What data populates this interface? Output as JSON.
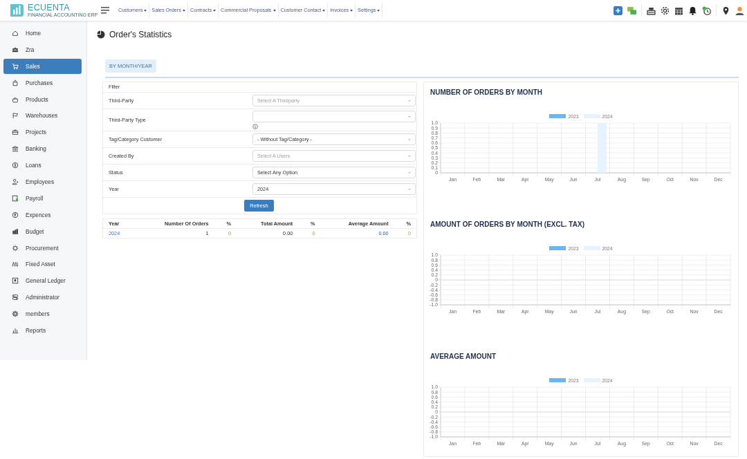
{
  "logo": {
    "name": "ECUENTA",
    "tagline": "FINANCIAL ACCOUNTING ERP"
  },
  "menu": [
    {
      "label": "Customers"
    },
    {
      "label": "Sales Orders"
    },
    {
      "label": "Contracts"
    },
    {
      "label": "Commercial Proposals"
    },
    {
      "label": "Customer Contact"
    },
    {
      "label": "Invoices"
    },
    {
      "label": "Settings"
    }
  ],
  "sidebar": {
    "items": [
      {
        "label": "Home",
        "selected": false
      },
      {
        "label": "Zra",
        "selected": false
      },
      {
        "label": "Sales",
        "selected": true
      },
      {
        "label": "Purchases",
        "selected": false
      },
      {
        "label": "Products",
        "selected": false
      },
      {
        "label": "Warehouses",
        "selected": false
      },
      {
        "label": "Projects",
        "selected": false
      },
      {
        "label": "Banking",
        "selected": false
      },
      {
        "label": "Loans",
        "selected": false
      },
      {
        "label": "Employees",
        "selected": false
      },
      {
        "label": "Payroll",
        "selected": false
      },
      {
        "label": "Expences",
        "selected": false
      },
      {
        "label": "Budget",
        "selected": false
      },
      {
        "label": "Procurement",
        "selected": false
      },
      {
        "label": "Fixed Asset",
        "selected": false
      },
      {
        "label": "General Ledger",
        "selected": false
      },
      {
        "label": "Administrator",
        "selected": false
      },
      {
        "label": "members",
        "selected": false
      },
      {
        "label": "Reports",
        "selected": false
      }
    ]
  },
  "page": {
    "title": "Order's Statistics"
  },
  "tabs": [
    {
      "label": "BY MONTH/YEAR",
      "selected": true
    }
  ],
  "filter": {
    "title": "Filter",
    "fields": [
      {
        "label": "Third-Party",
        "placeholder": "Select A Thirdparty",
        "info": false
      },
      {
        "label": "Third-Party Type",
        "info": true
      },
      {
        "label": "Tag/Category Customer",
        "value": "- Without Tag/Category -",
        "info": false
      },
      {
        "label": "Created By",
        "placeholder": "Select A Users",
        "info": false
      },
      {
        "label": "Status",
        "value": "Select Any Option",
        "info": false
      },
      {
        "label": "Year",
        "value": "2024",
        "info": false
      }
    ],
    "button": "Refresh"
  },
  "table": {
    "columns": [
      "Year",
      "Number Of Orders",
      "%",
      "Total Amount",
      "%",
      "Average Amount",
      "%"
    ],
    "rows": [
      [
        {
          "text": "2024",
          "kind": "link"
        },
        {
          "text": "1",
          "kind": "number"
        },
        {
          "text": "0",
          "kind": "percent"
        },
        {
          "text": "0.00",
          "kind": "number"
        },
        {
          "text": "0",
          "kind": "percent"
        },
        {
          "text": "0.00",
          "kind": "amount"
        },
        {
          "text": "0",
          "kind": "percent"
        }
      ]
    ]
  },
  "charts": [
    {
      "title": "NUMBER OF ORDERS BY MONTH",
      "chart_data": {
        "type": "bar",
        "grid": true,
        "categories": [
          "Jan",
          "Feb",
          "Mar",
          "Apr",
          "May",
          "Jun",
          "Jul",
          "Aug",
          "Sep",
          "Oct",
          "Nov",
          "Dec"
        ],
        "series": [
          {
            "name": "2023",
            "color": "#6bb5f0",
            "values": [
              0,
              0,
              0,
              0,
              0,
              0,
              0,
              0,
              0,
              0,
              0,
              0
            ]
          },
          {
            "name": "2024",
            "color": "#e6f2fd",
            "values": [
              0,
              0,
              0,
              0,
              0,
              0,
              1,
              0,
              0,
              0,
              0,
              0
            ]
          }
        ],
        "ylim": [
          0,
          1
        ],
        "yticks": [
          {
            "value": 0,
            "label": "0"
          },
          {
            "value": 0.1,
            "label": "0.1"
          },
          {
            "value": 0.2,
            "label": "0.2"
          },
          {
            "value": 0.3,
            "label": "0.3"
          },
          {
            "value": 0.4,
            "label": "0.4"
          },
          {
            "value": 0.5,
            "label": "0.5"
          },
          {
            "value": 0.6,
            "label": "0.6"
          },
          {
            "value": 0.7,
            "label": "0.7"
          },
          {
            "value": 0.8,
            "label": "0.8"
          },
          {
            "value": 0.9,
            "label": "0.9"
          },
          {
            "value": 1,
            "label": "1.0"
          }
        ]
      }
    },
    {
      "title": "AMOUNT OF ORDERS BY MONTH (EXCL. TAX)",
      "chart_data": {
        "type": "bar",
        "grid": true,
        "categories": [
          "Jan",
          "Feb",
          "Mar",
          "Apr",
          "May",
          "Jun",
          "Jul",
          "Aug",
          "Sep",
          "Oct",
          "Nov",
          "Dec"
        ],
        "series": [
          {
            "name": "2023",
            "color": "#6bb5f0",
            "values": [
              0,
              0,
              0,
              0,
              0,
              0,
              0,
              0,
              0,
              0,
              0,
              0
            ]
          },
          {
            "name": "2024",
            "color": "#e6f2fd",
            "values": [
              0,
              0,
              0,
              0,
              0,
              0,
              0,
              0,
              0,
              0,
              0,
              0
            ]
          }
        ],
        "ylim": [
          -1,
          1
        ],
        "yticks": [
          {
            "value": -1,
            "label": "-1.0"
          },
          {
            "value": -0.8,
            "label": "-0.8"
          },
          {
            "value": -0.6,
            "label": "-0.6"
          },
          {
            "value": -0.4,
            "label": "-0.4"
          },
          {
            "value": -0.2,
            "label": "-0.2"
          },
          {
            "value": 0,
            "label": "0"
          },
          {
            "value": 0.2,
            "label": "0.2"
          },
          {
            "value": 0.4,
            "label": "0.4"
          },
          {
            "value": 0.6,
            "label": "0.6"
          },
          {
            "value": 0.8,
            "label": "0.8"
          },
          {
            "value": 1,
            "label": "1.0"
          }
        ]
      }
    },
    {
      "title": "AVERAGE AMOUNT",
      "chart_data": {
        "type": "bar",
        "grid": true,
        "categories": [
          "Jan",
          "Feb",
          "Mar",
          "Apr",
          "May",
          "Jun",
          "Jul",
          "Aug",
          "Sep",
          "Oct",
          "Nov",
          "Dec"
        ],
        "series": [
          {
            "name": "2023",
            "color": "#6bb5f0",
            "values": [
              0,
              0,
              0,
              0,
              0,
              0,
              0,
              0,
              0,
              0,
              0,
              0
            ]
          },
          {
            "name": "2024",
            "color": "#e6f2fd",
            "values": [
              0,
              0,
              0,
              0,
              0,
              0,
              0,
              0,
              0,
              0,
              0,
              0
            ]
          }
        ],
        "ylim": [
          -1,
          1
        ],
        "yticks": [
          {
            "value": -1,
            "label": "-1.0"
          },
          {
            "value": -0.8,
            "label": "-0.8"
          },
          {
            "value": -0.6,
            "label": "-0.6"
          },
          {
            "value": -0.4,
            "label": "-0.4"
          },
          {
            "value": -0.2,
            "label": "-0.2"
          },
          {
            "value": 0,
            "label": "0"
          },
          {
            "value": 0.2,
            "label": "0.2"
          },
          {
            "value": 0.4,
            "label": "0.4"
          },
          {
            "value": 0.6,
            "label": "0.6"
          },
          {
            "value": 0.8,
            "label": "0.8"
          },
          {
            "value": 1,
            "label": "1.0"
          }
        ]
      }
    }
  ]
}
